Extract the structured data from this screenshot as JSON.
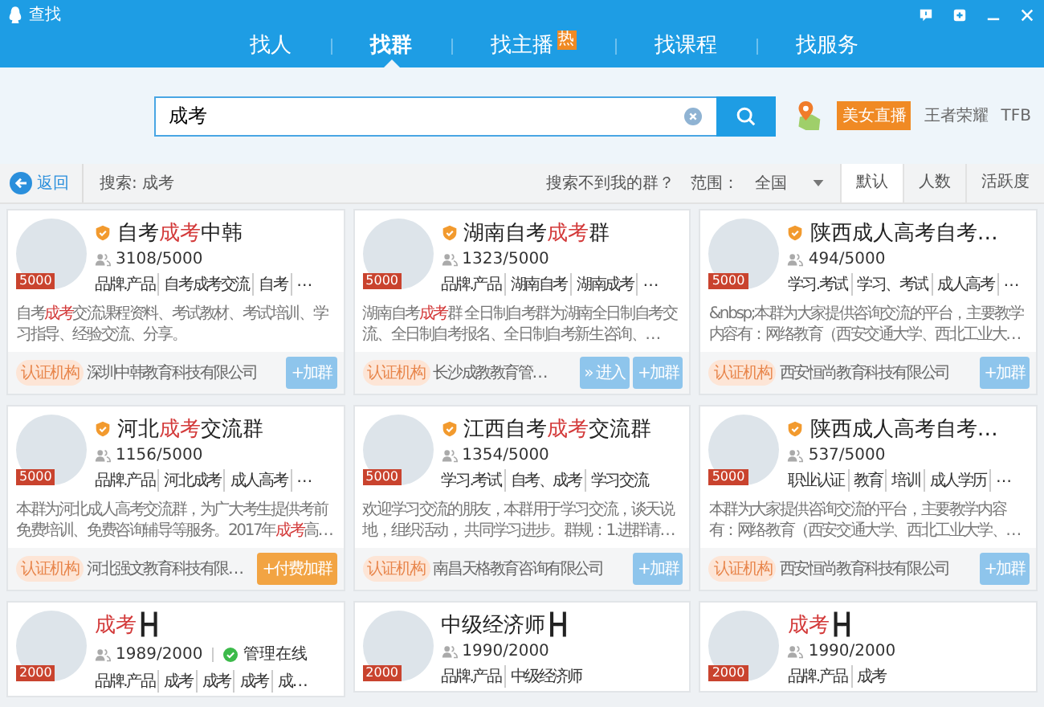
{
  "window": {
    "title": "查找"
  },
  "tabs": [
    {
      "label": "找人",
      "selected": false
    },
    {
      "label": "找群",
      "selected": true
    },
    {
      "label": "找主播",
      "selected": false,
      "badge": "热"
    },
    {
      "label": "找课程",
      "selected": false
    },
    {
      "label": "找服务",
      "selected": false
    }
  ],
  "search": {
    "value": "成考"
  },
  "promos": [
    {
      "label": "美女直播",
      "kind": "badge"
    },
    {
      "label": "王者荣耀",
      "kind": "text"
    },
    {
      "label": "TFB",
      "kind": "text"
    }
  ],
  "filter_bar": {
    "back": "返回",
    "query": "搜索: 成考",
    "help_link": "搜索不到我的群？",
    "scope_label": "范围：",
    "scope_value": "全国",
    "sort_tabs": [
      {
        "label": "默认",
        "selected": true
      },
      {
        "label": "人数",
        "selected": false
      },
      {
        "label": "活跃度",
        "selected": false
      }
    ]
  },
  "groups": [
    {
      "name": [
        {
          "text": "自考",
          "highlight": false
        },
        {
          "text": "成考",
          "highlight": true
        },
        {
          "text": "中韩",
          "highlight": false
        }
      ],
      "verified": true,
      "level_badge": "5000",
      "members": "3108/5000",
      "tags": [
        "品牌.产品",
        "自考成考交流",
        "自考",
        "…"
      ],
      "description": [
        {
          "text": "自考",
          "highlight": false
        },
        {
          "text": "成考",
          "highlight": true
        },
        {
          "text": "交流课程资料、考试教材、考试培训、学习指导、经验交流、分享。",
          "highlight": false
        }
      ],
      "certified_label": "认证机构",
      "organization": "深圳中韩教育科技有限公司",
      "buttons": [
        {
          "label": "+加群",
          "kind": "join"
        }
      ]
    },
    {
      "name": [
        {
          "text": "湖南自考",
          "highlight": false
        },
        {
          "text": "成考",
          "highlight": true
        },
        {
          "text": "群",
          "highlight": false
        }
      ],
      "verified": true,
      "level_badge": "5000",
      "members": "1323/5000",
      "tags": [
        "品牌.产品",
        "湖南自考",
        "湖南成考",
        "…"
      ],
      "description": [
        {
          "text": "湖南自考",
          "highlight": false
        },
        {
          "text": "成考",
          "highlight": true
        },
        {
          "text": "群 全日制自考群为湖南全日制自考交流、全日制自考报名、全日制自考新生咨询、…",
          "highlight": false
        }
      ],
      "certified_label": "认证机构",
      "organization": "长沙成教教育管…",
      "buttons": [
        {
          "label": "» 进入",
          "kind": "enter"
        },
        {
          "label": "+加群",
          "kind": "join"
        }
      ]
    },
    {
      "name": [
        {
          "text": "陕西成人高考自考…",
          "highlight": false
        }
      ],
      "verified": true,
      "level_badge": "5000",
      "members": "494/5000",
      "tags": [
        "学习.考试",
        "学习、考试",
        "成人高考",
        "…"
      ],
      "description": [
        {
          "text": "&nbsp;本群为大家提供咨询交流的平台，主要教学内容有：网络教育（西安交通大学、西北工业大…",
          "highlight": false
        }
      ],
      "certified_label": "认证机构",
      "organization": "西安恒尚教育科技有限公司",
      "buttons": [
        {
          "label": "+加群",
          "kind": "join"
        }
      ]
    },
    {
      "name": [
        {
          "text": "河北",
          "highlight": false
        },
        {
          "text": "成考",
          "highlight": true
        },
        {
          "text": "交流群",
          "highlight": false
        }
      ],
      "verified": true,
      "level_badge": "5000",
      "members": "1156/5000",
      "tags": [
        "品牌.产品",
        "河北成考",
        "成人高考",
        "…"
      ],
      "description": [
        {
          "text": "本群为河北成人高考交流群，为广大考生提供考前免费培训、免费咨询辅导等服务。2017年",
          "highlight": false
        },
        {
          "text": "成考",
          "highlight": true
        },
        {
          "text": "高…",
          "highlight": false
        }
      ],
      "certified_label": "认证机构",
      "organization": "河北强文教育科技有限…",
      "buttons": [
        {
          "label": "+付费加群",
          "kind": "paid_join"
        }
      ]
    },
    {
      "name": [
        {
          "text": "江西自考",
          "highlight": false
        },
        {
          "text": "成考",
          "highlight": true
        },
        {
          "text": "交流群",
          "highlight": false
        }
      ],
      "verified": true,
      "level_badge": "5000",
      "members": "1354/5000",
      "tags": [
        "学习.考试",
        "自考、成考",
        "学习交流"
      ],
      "description": [
        {
          "text": "欢迎学习交流的朋友，本群用于学习交流，谈天说地，组织活动， 共同学习进步。群规：1.进群请…",
          "highlight": false
        }
      ],
      "certified_label": "认证机构",
      "organization": "南昌天格教育咨询有限公司",
      "buttons": [
        {
          "label": "+加群",
          "kind": "join"
        }
      ]
    },
    {
      "name": [
        {
          "text": "陕西成人高考自考…",
          "highlight": false
        }
      ],
      "verified": true,
      "level_badge": "5000",
      "members": "537/5000",
      "tags": [
        "职业认证",
        "教育",
        "培训",
        "成人学历",
        "…"
      ],
      "description": [
        {
          "text": "本群为大家提供咨询交流的平台，主要教学内容有：网络教育（西安交通大学、西北工业大学、…",
          "highlight": false
        }
      ],
      "certified_label": "认证机构",
      "organization": "西安恒尚教育科技有限公司",
      "buttons": [
        {
          "label": "+加群",
          "kind": "join"
        }
      ]
    },
    {
      "name": [
        {
          "text": "成考",
          "highlight": true
        },
        {
          "text": "┣┫",
          "highlight": false
        }
      ],
      "verified": false,
      "level_badge": "2000",
      "members": "1989/2000",
      "admin_status": "管理在线",
      "tags": [
        "品牌.产品",
        "成考",
        "成考",
        "成考",
        "成…"
      ]
    },
    {
      "name": [
        {
          "text": "中级经济师┣┫",
          "highlight": false
        }
      ],
      "verified": false,
      "level_badge": "2000",
      "members": "1990/2000",
      "tags": [
        "品牌.产品",
        "中级经济师"
      ]
    },
    {
      "name": [
        {
          "text": "成考",
          "highlight": true
        },
        {
          "text": "┣┫",
          "highlight": false
        }
      ],
      "verified": false,
      "level_badge": "2000",
      "members": "1990/2000",
      "tags": [
        "品牌.产品",
        "成考"
      ]
    }
  ]
}
